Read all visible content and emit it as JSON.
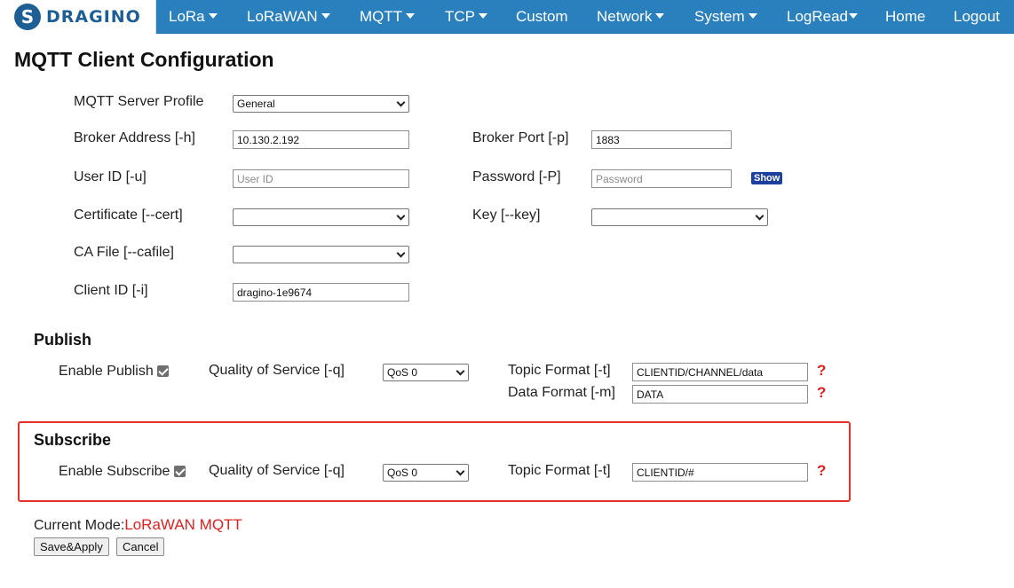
{
  "brand": {
    "name": "DRAGINO",
    "mark": "S"
  },
  "nav": {
    "items": [
      {
        "label": "LoRa",
        "dropdown": true
      },
      {
        "label": "LoRaWAN",
        "dropdown": true
      },
      {
        "label": "MQTT",
        "dropdown": true
      },
      {
        "label": "TCP",
        "dropdown": true
      },
      {
        "label": "Custom",
        "dropdown": false
      },
      {
        "label": "Network",
        "dropdown": true
      },
      {
        "label": "System",
        "dropdown": true
      },
      {
        "label": "LogRead",
        "dropdown": true
      },
      {
        "label": "Home",
        "dropdown": false
      },
      {
        "label": "Logout",
        "dropdown": false
      }
    ],
    "bg_color": "#2a7fbd"
  },
  "page_title": "MQTT Client Configuration",
  "form": {
    "server_profile": {
      "label": "MQTT Server Profile",
      "value": "General"
    },
    "broker_address": {
      "label": "Broker Address [-h]",
      "value": "10.130.2.192"
    },
    "broker_port": {
      "label": "Broker Port [-p]",
      "value": "1883"
    },
    "user_id": {
      "label": "User ID [-u]",
      "value": "",
      "placeholder": "User ID"
    },
    "password": {
      "label": "Password [-P]",
      "value": "",
      "placeholder": "Password",
      "show_label": "Show"
    },
    "certificate": {
      "label": "Certificate [--cert]",
      "value": ""
    },
    "key": {
      "label": "Key [--key]",
      "value": ""
    },
    "ca_file": {
      "label": "CA File [--cafile]",
      "value": ""
    },
    "client_id": {
      "label": "Client ID [-i]",
      "value": "dragino-1e9674"
    }
  },
  "publish": {
    "heading": "Publish",
    "enable_label": "Enable Publish",
    "enabled": true,
    "qos_label": "Quality of Service [-q]",
    "qos_value": "QoS 0",
    "topic_label": "Topic Format [-t]",
    "topic_value": "CLIENTID/CHANNEL/data",
    "data_label": "Data Format [-m]",
    "data_value": "DATA",
    "help": "?"
  },
  "subscribe": {
    "heading": "Subscribe",
    "enable_label": "Enable Subscribe",
    "enabled": true,
    "qos_label": "Quality of Service [-q]",
    "qos_value": "QoS 0",
    "topic_label": "Topic Format [-t]",
    "topic_value": "CLIENTID/#",
    "help": "?",
    "highlight_color": "#e5302a"
  },
  "mode": {
    "label": "Current Mode:",
    "value": "LoRaWAN MQTT",
    "value_color": "#e02020"
  },
  "actions": {
    "save": "Save&Apply",
    "cancel": "Cancel"
  }
}
